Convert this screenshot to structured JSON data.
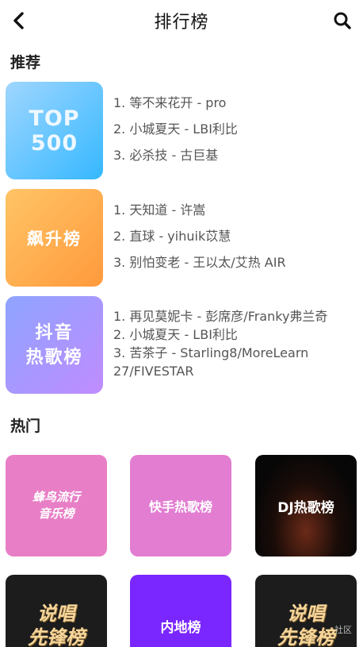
{
  "header": {
    "title": "排行榜",
    "back_icon": "chevron-left-icon",
    "search_icon": "search-icon"
  },
  "recommend": {
    "title": "推荐",
    "charts": [
      {
        "cover": [
          "TOP",
          "500"
        ],
        "lines": [
          "1. 等不来花开 - pro",
          "2. 小城夏天 - LBI利比",
          "3. 必杀技 - 古巨基"
        ]
      },
      {
        "cover": [
          "飙升榜"
        ],
        "lines": [
          "1. 天知道 - 许嵩",
          "2. 直球 - yihuik苡慧",
          "3. 别怕变老 - 王以太/艾热 AIR"
        ]
      },
      {
        "cover": [
          "抖音",
          "热歌榜"
        ],
        "lines": [
          "1. 再见莫妮卡 - 彭席彦/Franky弗兰奇",
          "2. 小城夏天 - LBI利比",
          "3. 苦茶子 - Starling8/MoreLearn 27/FIVESTAR"
        ]
      }
    ]
  },
  "hot": {
    "title": "热门",
    "tiles": [
      [
        "蜂鸟流行",
        "音乐榜"
      ],
      [
        "快手热歌榜"
      ],
      [
        "DJ热歌榜"
      ],
      [
        "说唱",
        "先锋榜"
      ],
      [
        "内地榜"
      ],
      [
        "说唱",
        "先锋榜"
      ]
    ]
  },
  "watermark": "社区"
}
